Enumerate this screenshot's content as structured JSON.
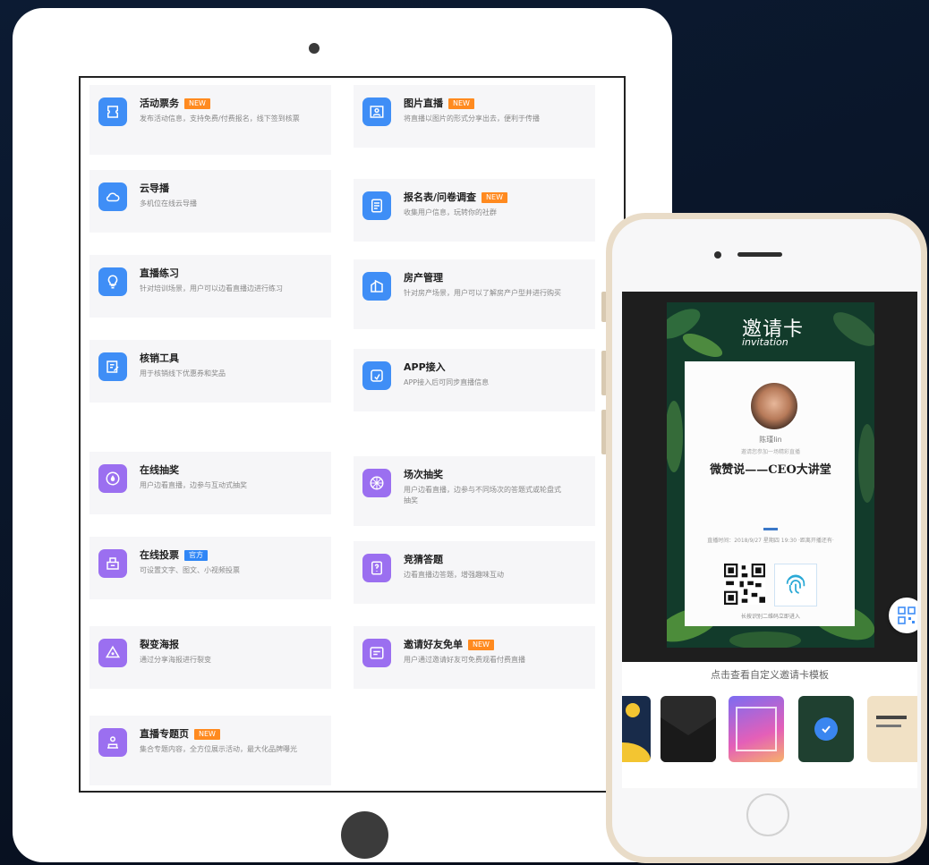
{
  "left_features": [
    {
      "title": "活动票务",
      "badge": "NEW",
      "badge_type": "new",
      "desc": "发布活动信息，支持免费/付费报名，线下签到核票",
      "icon": "ticket-icon",
      "color": "blue"
    },
    {
      "title": "云导播",
      "badge": "",
      "badge_type": "",
      "desc": "多机位在线云导播",
      "icon": "cloud-icon",
      "color": "blue"
    },
    {
      "title": "直播练习",
      "badge": "",
      "badge_type": "",
      "desc": "针对培训场景，用户可以边看直播边进行练习",
      "icon": "lightbulb-icon",
      "color": "blue"
    },
    {
      "title": "核销工具",
      "badge": "",
      "badge_type": "",
      "desc": "用于核销线下优惠券和奖品",
      "icon": "edit-icon",
      "color": "blue"
    },
    {
      "title": "在线抽奖",
      "badge": "",
      "badge_type": "",
      "desc": "用户边看直播，边参与互动式抽奖",
      "icon": "drop-icon",
      "color": "purple"
    },
    {
      "title": "在线投票",
      "badge": "官方",
      "badge_type": "blue",
      "desc": "可设置文字、图文、小视频投票",
      "icon": "ballot-box-icon",
      "color": "purple"
    },
    {
      "title": "裂变海报",
      "badge": "",
      "badge_type": "",
      "desc": "通过分享海报进行裂变",
      "icon": "poster-icon",
      "color": "purple"
    },
    {
      "title": "直播专题页",
      "badge": "NEW",
      "badge_type": "new",
      "desc": "集合专题内容，全方位展示活动，最大化品牌曝光",
      "icon": "topic-icon",
      "color": "purple"
    }
  ],
  "right_features": [
    {
      "title": "图片直播",
      "badge": "NEW",
      "badge_type": "new",
      "desc": "将直播以图片的形式分享出去，便利于传播",
      "icon": "photo-icon",
      "color": "blue"
    },
    {
      "title": "报名表/问卷调查",
      "badge": "NEW",
      "badge_type": "new",
      "desc": "收集用户信息，玩转你的社群",
      "icon": "form-icon",
      "color": "blue"
    },
    {
      "title": "房产管理",
      "badge": "",
      "badge_type": "",
      "desc": "针对房产场景，用户可以了解房产户型并进行购买",
      "icon": "building-icon",
      "color": "blue"
    },
    {
      "title": "APP接入",
      "badge": "",
      "badge_type": "",
      "desc": "APP接入后可同步直播信息",
      "icon": "app-link-icon",
      "color": "blue"
    },
    {
      "title": "场次抽奖",
      "badge": "",
      "badge_type": "",
      "desc": "用户边看直播，边参与不同场次的答题式或轮盘式抽奖",
      "icon": "wheel-icon",
      "color": "purple"
    },
    {
      "title": "竞猜答题",
      "badge": "",
      "badge_type": "",
      "desc": "边看直播边答题，增强趣味互动",
      "icon": "quiz-icon",
      "color": "purple"
    },
    {
      "title": "邀请好友免单",
      "badge": "NEW",
      "badge_type": "new",
      "desc": "用户通过邀请好友可免费观看付费直播",
      "icon": "invite-icon",
      "color": "purple"
    }
  ],
  "phone": {
    "invitation_title_cn": "邀请卡",
    "invitation_title_en": "invitation",
    "host_name": "陈瑾lin",
    "host_subtitle": "邀请您参加一场精彩直播",
    "event_title": "微赞说——CEO大讲堂",
    "event_meta": "直播时间：2018/9/27 星期四 19:30 ·距离开播还有·",
    "qr_caption": "长按识别二维码立即进入",
    "template_label": "点击查看自定义邀请卡模板",
    "thumb_colors": [
      "#182b4a",
      "#2a2a2a",
      "#e45fb8",
      "#1f4030",
      "#f1e1c5"
    ]
  },
  "colors": {
    "blue": "#3f8ef6",
    "purple": "#9b6ff0",
    "new_badge": "#ff8a1f",
    "phone_frame": "#e9dcc8"
  }
}
